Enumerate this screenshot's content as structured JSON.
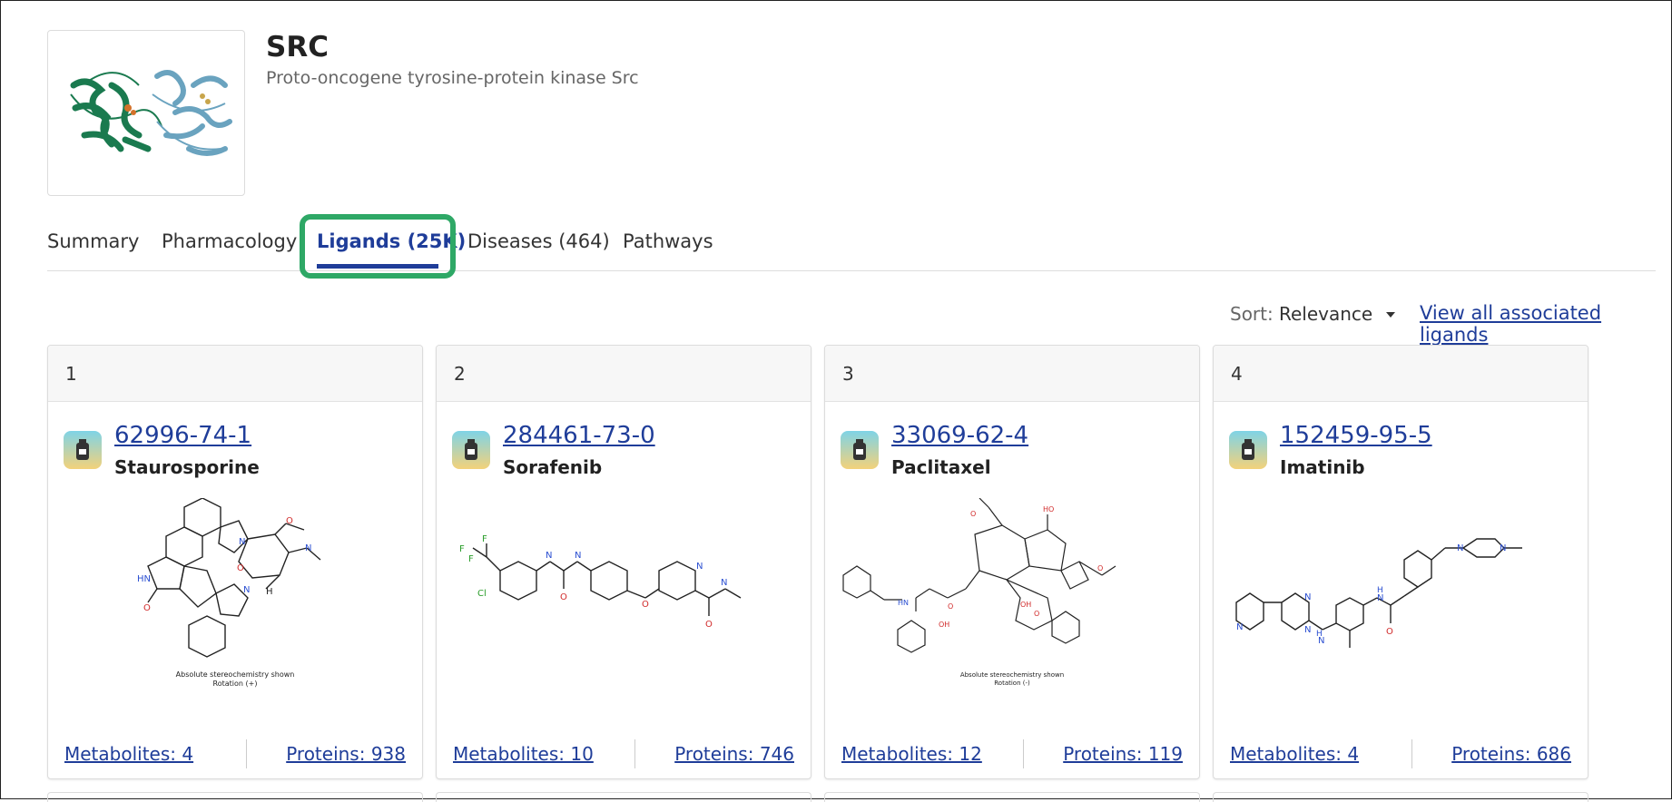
{
  "target": {
    "symbol": "SRC",
    "full_name": "Proto-oncogene tyrosine-protein kinase Src"
  },
  "tabs": [
    {
      "label": "Summary",
      "active": false
    },
    {
      "label": "Pharmacology",
      "active": false
    },
    {
      "label": "Ligands (25K)",
      "active": true
    },
    {
      "label": "Diseases (464)",
      "active": false
    },
    {
      "label": "Pathways",
      "active": false
    }
  ],
  "sort": {
    "label": "Sort:",
    "value": "Relevance",
    "view_all": "View all associated ligands"
  },
  "cards": [
    {
      "rank": "1",
      "id": "62996-74-1",
      "name": "Staurosporine",
      "metabolites": "Metabolites: 4",
      "proteins": "Proteins: 938",
      "note_line1": "Absolute stereochemistry shown",
      "note_line2": "Rotation (+)"
    },
    {
      "rank": "2",
      "id": "284461-73-0",
      "name": "Sorafenib",
      "metabolites": "Metabolites: 10",
      "proteins": "Proteins: 746",
      "note_line1": "",
      "note_line2": ""
    },
    {
      "rank": "3",
      "id": "33069-62-4",
      "name": "Paclitaxel",
      "metabolites": "Metabolites: 12",
      "proteins": "Proteins: 119",
      "note_line1": "Absolute stereochemistry shown",
      "note_line2": "Rotation (-)"
    },
    {
      "rank": "4",
      "id": "152459-95-5",
      "name": "Imatinib",
      "metabolites": "Metabolites: 4",
      "proteins": "Proteins: 686",
      "note_line1": "",
      "note_line2": ""
    }
  ],
  "colors": {
    "link": "#1f3d99",
    "highlight": "#2ea866",
    "protein_green": "#1a7a4f",
    "protein_blue": "#6aa3bf"
  }
}
